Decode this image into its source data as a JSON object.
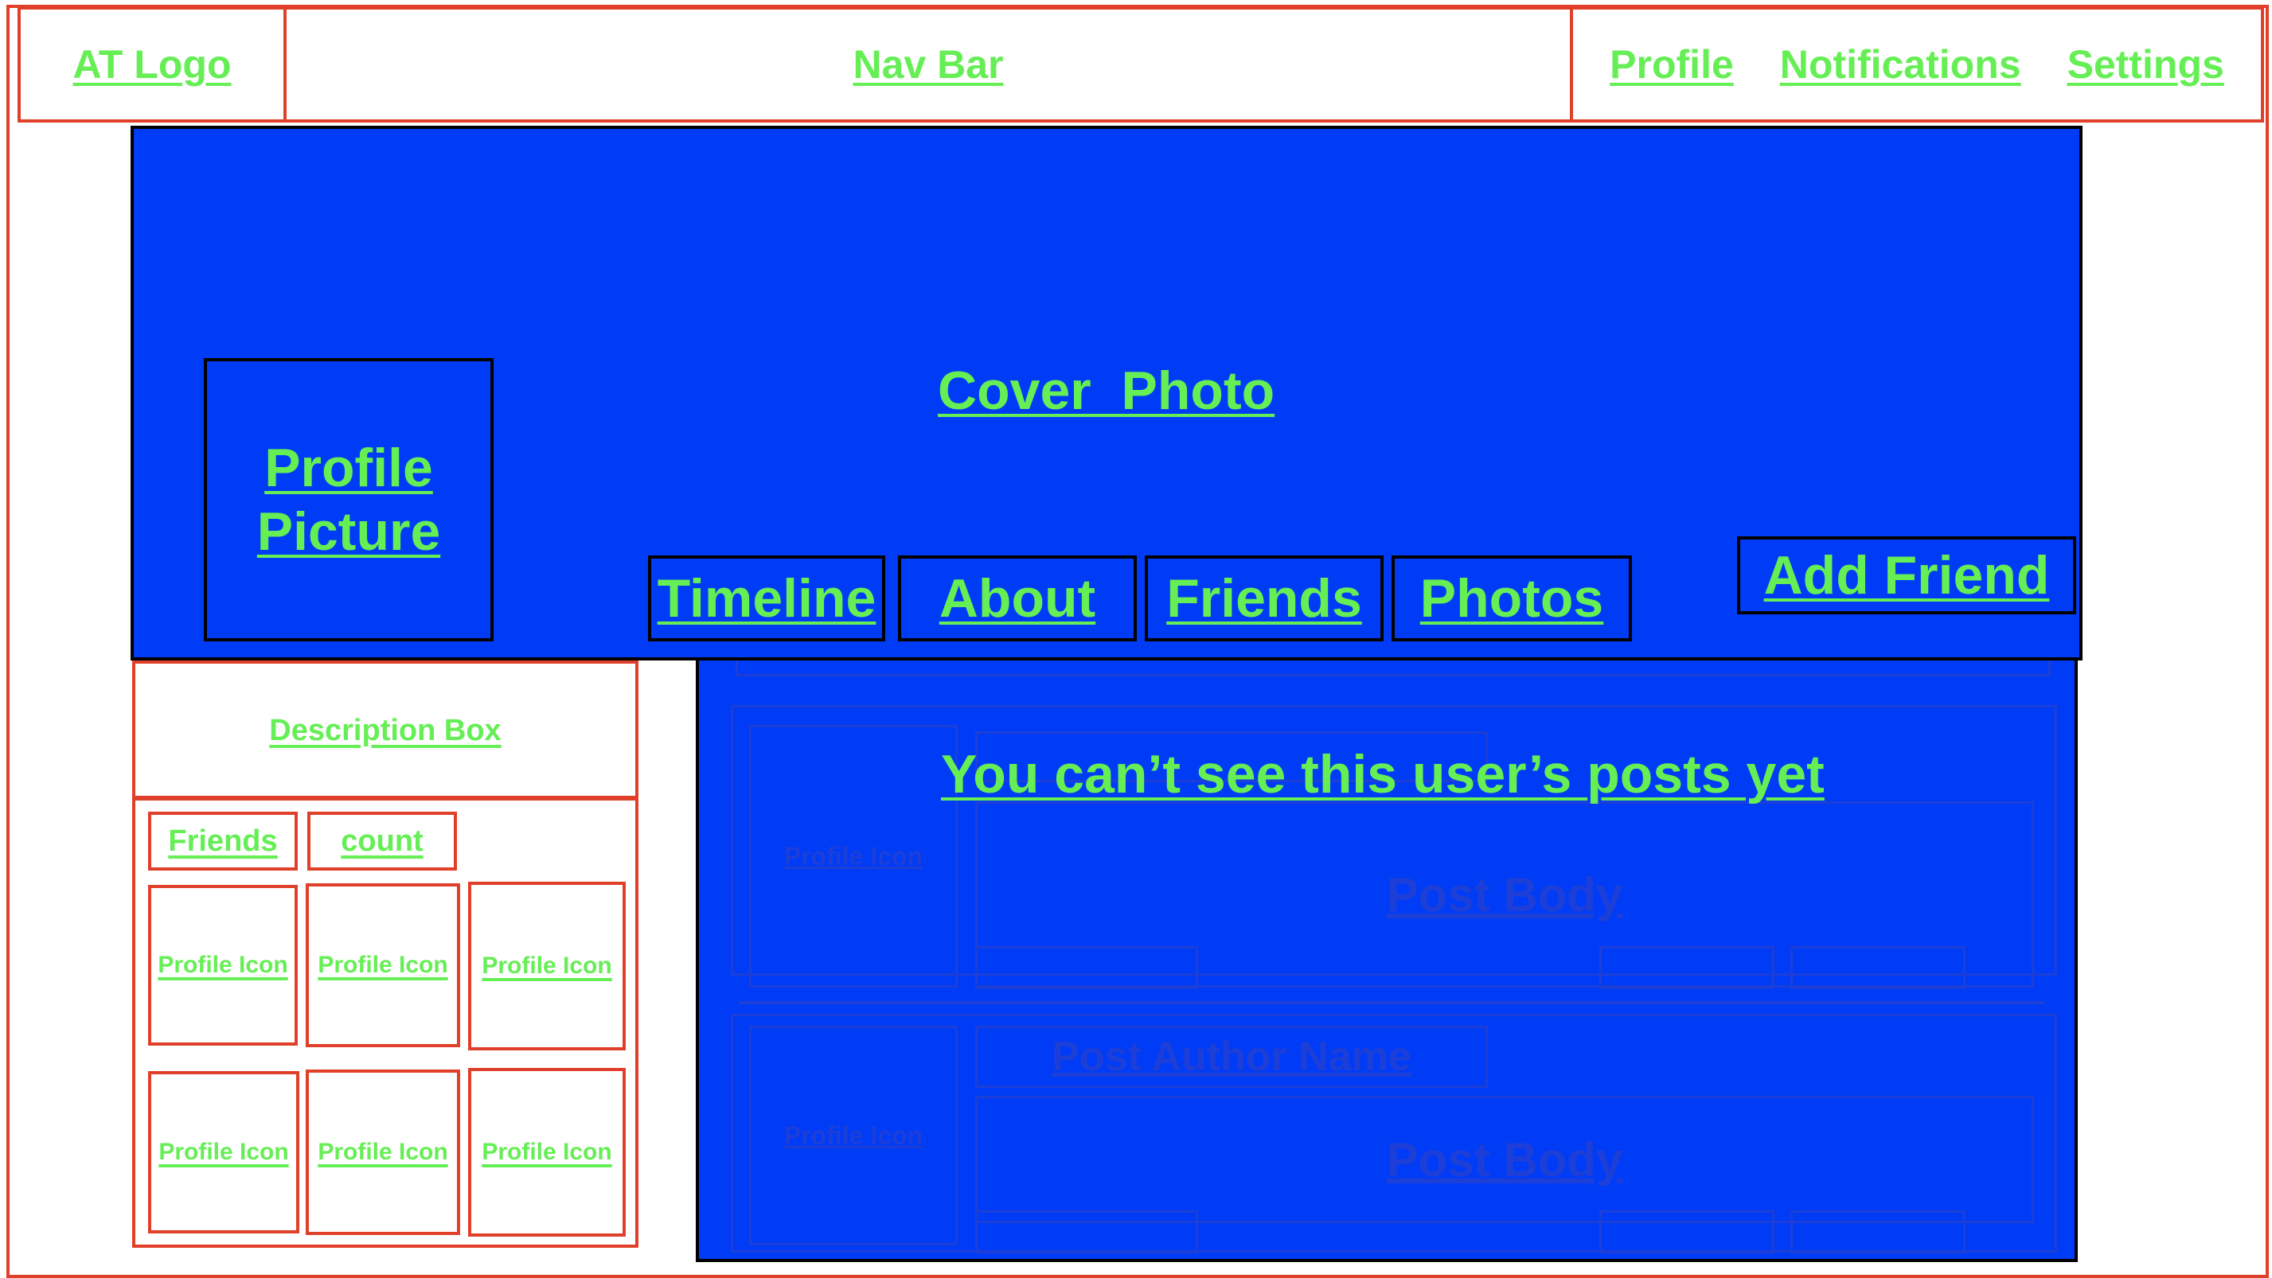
{
  "header": {
    "logo": "AT Logo",
    "nav": "Nav Bar",
    "links": [
      "Profile",
      "Notifications",
      "Settings"
    ]
  },
  "cover": {
    "title": "Cover  Photo",
    "profile_picture": "Profile Picture",
    "tabs": [
      "Timeline",
      "About",
      "Friends",
      "Photos"
    ],
    "add_friend": "Add Friend"
  },
  "sidebar": {
    "description": "Description Box",
    "friends_label": "Friends",
    "count_label": "count",
    "friend_icons": [
      "Profile Icon",
      "Profile Icon",
      "Profile Icon",
      "Profile Icon",
      "Profile Icon",
      "Profile Icon"
    ]
  },
  "feed": {
    "message": "You can’t see this user’s posts yet",
    "posts": [
      {
        "icon": "Profile Icon",
        "body": "Post Body"
      },
      {
        "icon": "Profile Icon",
        "author": "Post Author Name",
        "body": "Post Body"
      }
    ]
  },
  "colors": {
    "blue": "#003cf5",
    "red": "#e0402a",
    "green": "#66ee55"
  }
}
